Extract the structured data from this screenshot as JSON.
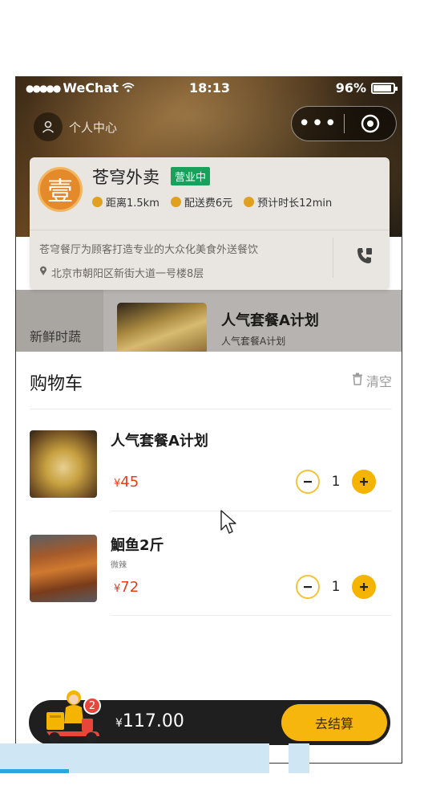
{
  "status_bar": {
    "carrier": "WeChat",
    "time": "18:13",
    "battery": "96%"
  },
  "header": {
    "profile_label": "个人中心"
  },
  "shop": {
    "name": "苍穹外卖",
    "status_badge": "营业中",
    "logo_char": "壹",
    "distance": "距离1.5km",
    "delivery_fee": "配送费6元",
    "eta": "预计时长12min",
    "description": "苍穹餐厅为顾客打造专业的大众化美食外送餐饮",
    "address": "北京市朝阳区新街大道一号楼8层"
  },
  "menu_preview": {
    "category": "新鲜时蔬",
    "dish_title": "人气套餐A计划",
    "dish_sub": "人气套餐A计划"
  },
  "cart": {
    "title": "购物车",
    "clear_label": "清空",
    "items": [
      {
        "name": "人气套餐A计划",
        "sub": "",
        "currency": "¥",
        "price": "45",
        "qty": "1"
      },
      {
        "name": "鮰鱼2斤",
        "sub": "微辣",
        "currency": "¥",
        "price": "72",
        "qty": "1"
      }
    ]
  },
  "cart_bar": {
    "badge_count": "2",
    "currency": "¥",
    "total": "117.00",
    "checkout_label": "去结算"
  },
  "colors": {
    "accent": "#f6b60d",
    "price": "#e33d1c",
    "open_badge": "#19a05a",
    "bar": "#1f1f1f"
  }
}
